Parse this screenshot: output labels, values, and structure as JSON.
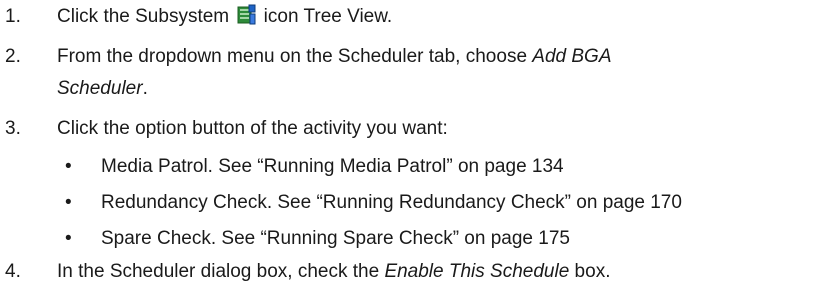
{
  "steps": [
    {
      "number": "1.",
      "text_before_icon": "Click the Subsystem ",
      "icon": "subsystem-icon",
      "text_after_icon": " icon Tree View."
    },
    {
      "number": "2.",
      "text_line1": "From the dropdown menu on the Scheduler tab, choose ",
      "emphasis_line1": "Add BGA",
      "emphasis_line2": "Scheduler",
      "text_line2_end": "."
    },
    {
      "number": "3.",
      "text": "Click the option button of the activity you want:",
      "bullets": [
        {
          "marker": "•",
          "text": "Media Patrol. See “Running Media Patrol” on page 134"
        },
        {
          "marker": "•",
          "text": "Redundancy Check. See “Running Redundancy Check” on page 170"
        },
        {
          "marker": "•",
          "text": "Spare Check. See “Running Spare Check” on page 175"
        }
      ]
    },
    {
      "number": "4.",
      "text_before": "In the Scheduler dialog box, check the ",
      "emphasis": "Enable This Schedule",
      "text_after": " box."
    }
  ]
}
